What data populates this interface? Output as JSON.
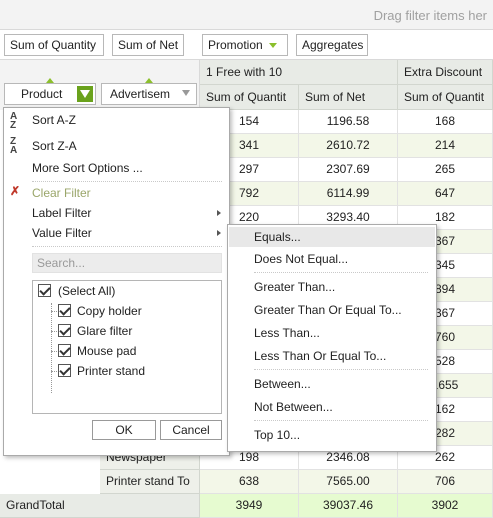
{
  "filter_area": {
    "hint": "Drag filter items her"
  },
  "column_fields": [
    {
      "label": "Sum of Quantity"
    },
    {
      "label": "Sum of Net"
    },
    {
      "label": "Promotion"
    },
    {
      "label": "Aggregates"
    }
  ],
  "row_fields": [
    {
      "label": "Product"
    },
    {
      "label": "Advertisem"
    }
  ],
  "column_headers": {
    "group1": "1 Free with 10",
    "group2": "Extra Discount",
    "sub1": "Sum of Quantit",
    "sub2": "Sum of Net",
    "sub3": "Sum of Quantit"
  },
  "rows": [
    {
      "label": "",
      "v1": "154",
      "v2": "1196.58",
      "v3": "168"
    },
    {
      "label": "",
      "v1": "341",
      "v2": "2610.72",
      "v3": "214"
    },
    {
      "label": "",
      "v1": "297",
      "v2": "2307.69",
      "v3": "265"
    },
    {
      "label": "",
      "v1": "792",
      "v2": "6114.99",
      "v3": "647"
    },
    {
      "label": "",
      "v1": "220",
      "v2": "3293.40",
      "v3": "182"
    },
    {
      "label": "",
      "v1": "",
      "v2": "",
      "v3": "367"
    },
    {
      "label": "",
      "v1": "",
      "v2": "",
      "v3": "345"
    },
    {
      "label": "",
      "v1": "",
      "v2": "",
      "v3": "894"
    },
    {
      "label": "",
      "v1": "",
      "v2": "",
      "v3": "367"
    },
    {
      "label": "",
      "v1": "",
      "v2": "",
      "v3": "760"
    },
    {
      "label": "",
      "v1": "",
      "v2": "",
      "v3": "528"
    },
    {
      "label": "",
      "v1": "",
      "v2": "",
      "v3": "1655"
    },
    {
      "label": "",
      "v1": "",
      "v2": "",
      "v3": "162"
    },
    {
      "label": "",
      "v1": "",
      "v2": "",
      "v3": "282"
    },
    {
      "label": "Newspaper",
      "v1": "198",
      "v2": "2346.08",
      "v3": "262"
    },
    {
      "label": "Printer stand To",
      "v1": "638",
      "v2": "7565.00",
      "v3": "706"
    }
  ],
  "grand_total": {
    "label": "GrandTotal",
    "v1": "3949",
    "v2": "39037.46",
    "v3": "3902"
  },
  "popup": {
    "sort_az": "Sort A-Z",
    "sort_za": "Sort Z-A",
    "more_sort": "More Sort Options ...",
    "clear_filter": "Clear Filter",
    "label_filter": "Label Filter",
    "value_filter": "Value Filter",
    "search_placeholder": "Search...",
    "items": [
      "(Select All)",
      "Copy holder",
      "Glare filter",
      "Mouse pad",
      "Printer stand"
    ],
    "ok": "OK",
    "cancel": "Cancel"
  },
  "submenu": {
    "equals": "Equals...",
    "not_equal": "Does Not Equal...",
    "greater": "Greater Than...",
    "greater_eq": "Greater Than Or Equal To...",
    "less": "Less Than...",
    "less_eq": "Less Than Or Equal To...",
    "between": "Between...",
    "not_between": "Not Between...",
    "top10": "Top 10..."
  },
  "colors": {
    "accent": "#8bbf2c",
    "filter_active": "#6aa21c",
    "header_bg": "#e8ebe6",
    "total_bg": "#e6fbd0"
  }
}
